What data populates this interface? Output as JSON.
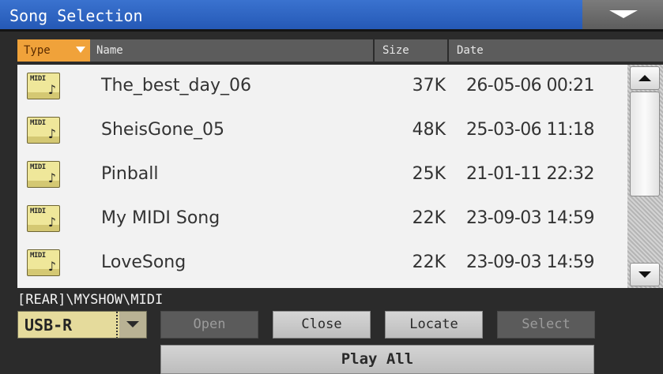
{
  "window": {
    "title": "Song Selection"
  },
  "header": {
    "type": "Type",
    "name": "Name",
    "size": "Size",
    "date": "Date"
  },
  "colors": {
    "title_bar": "#2e64c4",
    "sort_header": "#f0a23a",
    "device_select": "#e5db9c",
    "midi_icon": "#efe79a"
  },
  "files": [
    {
      "icon": "midi-file-icon",
      "icon_label": "MIDI",
      "name": "The_best_day_06",
      "size": "37K",
      "date": "26-05-06 00:21"
    },
    {
      "icon": "midi-file-icon",
      "icon_label": "MIDI",
      "name": "SheisGone_05",
      "size": "48K",
      "date": "25-03-06 11:18"
    },
    {
      "icon": "midi-file-icon",
      "icon_label": "MIDI",
      "name": "Pinball",
      "size": "25K",
      "date": "21-01-11 22:32"
    },
    {
      "icon": "midi-file-icon",
      "icon_label": "MIDI",
      "name": "My MIDI Song",
      "size": "22K",
      "date": "23-09-03 14:59"
    },
    {
      "icon": "midi-file-icon",
      "icon_label": "MIDI",
      "name": "LoveSong",
      "size": "22K",
      "date": "23-09-03 14:59"
    }
  ],
  "path": "[REAR]\\MYSHOW\\MIDI",
  "device": {
    "selected": "USB-R"
  },
  "buttons": {
    "open": "Open",
    "close": "Close",
    "locate": "Locate",
    "select": "Select",
    "play_all": "Play All"
  }
}
